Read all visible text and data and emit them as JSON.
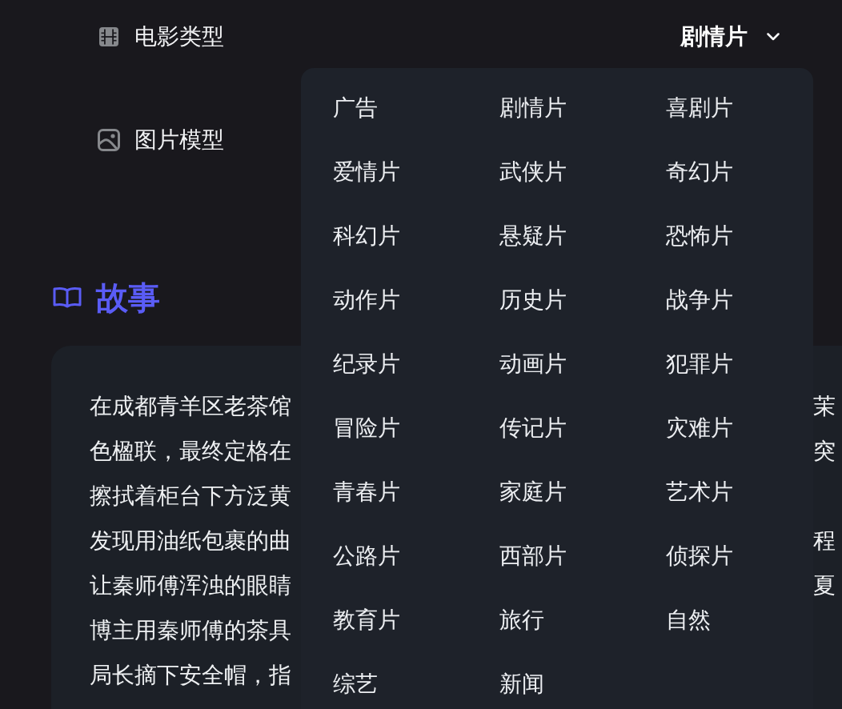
{
  "settings": [
    {
      "label": "电影类型",
      "value": "剧情片",
      "expanded": true,
      "options": [
        "广告",
        "剧情片",
        "喜剧片",
        "爱情片",
        "武侠片",
        "奇幻片",
        "科幻片",
        "悬疑片",
        "恐怖片",
        "动作片",
        "历史片",
        "战争片",
        "纪录片",
        "动画片",
        "犯罪片",
        "冒险片",
        "传记片",
        "灾难片",
        "青春片",
        "家庭片",
        "艺术片",
        "公路片",
        "西部片",
        "侦探片",
        "教育片",
        "旅行",
        "自然",
        "综艺",
        "新闻"
      ]
    },
    {
      "label": "图片模型"
    }
  ],
  "story": {
    "title": "故事",
    "lines": [
      {
        "start": "在成都青羊区老茶馆",
        "end": "茉"
      },
      {
        "start": "色楹联，最终定格在",
        "end": "突"
      },
      {
        "start": "擦拭着柜台下方泛黄"
      },
      {
        "start": "发现用油纸包裹的曲",
        "end": "程"
      },
      {
        "start": "让秦师傅浑浊的眼睛",
        "end": "夏"
      },
      {
        "start": "博主用秦师傅的茶具"
      },
      {
        "start": "局长摘下安全帽，指"
      }
    ]
  }
}
